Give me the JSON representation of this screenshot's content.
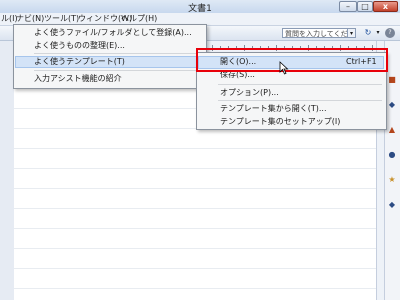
{
  "window": {
    "title": "文書1",
    "min_label": "–",
    "max_label": "□",
    "close_label": "x"
  },
  "menubar": {
    "items": [
      "ル(I)",
      "ナビ(N)",
      "ツール(T)",
      "ウィンドウ(W)",
      "ヘルプ(H)"
    ]
  },
  "toolbar": {
    "help_placeholder": "質問を入力してください",
    "dropdown_glyph": "▾",
    "help_button": "?"
  },
  "menu1": {
    "items": [
      "よく使うファイル/フォルダとして登録(A)...",
      "よく使うものの整理(E)...",
      "よく使うテンプレート(T)",
      "入力アシスト機能の紹介"
    ],
    "submenu_arrow": "▸"
  },
  "menu2": {
    "items": [
      "開く(O)...",
      "保存(S)...",
      "オプション(P)...",
      "テンプレート集から開く(T)...",
      "テンプレート集のセットアップ(I)"
    ],
    "open_shortcut": "Ctrl+F1"
  },
  "colors": {
    "highlight": "#d3e3f7",
    "annotation_red": "#e8000a"
  }
}
